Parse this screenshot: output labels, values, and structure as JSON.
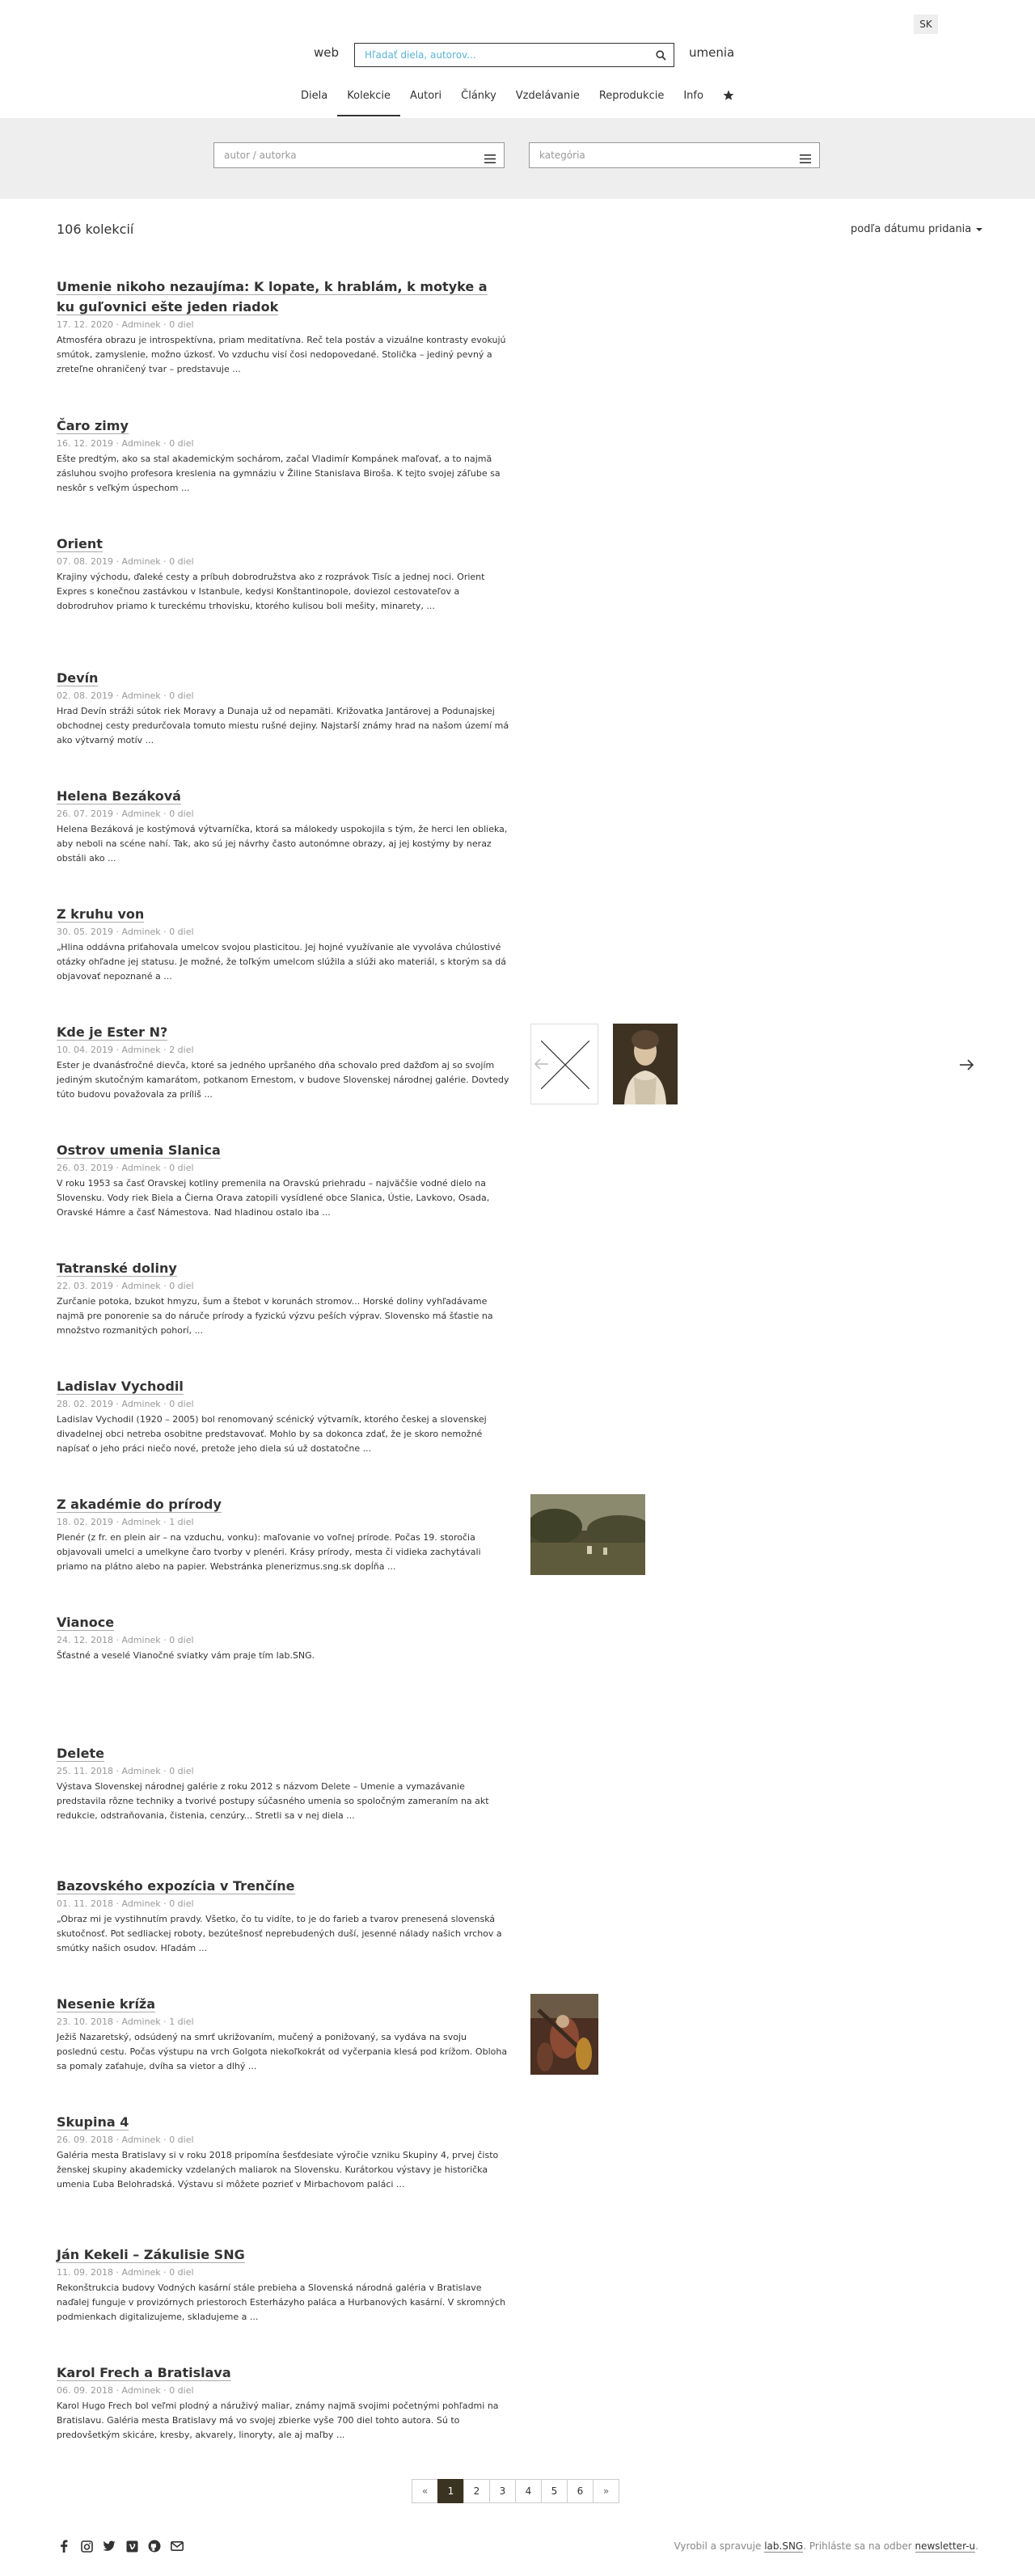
{
  "header": {
    "lang": "SK",
    "brand_left": "web",
    "brand_right": "umenia",
    "search_placeholder": "Hľadať diela, autorov..."
  },
  "nav": {
    "items": [
      {
        "label": "Diela"
      },
      {
        "label": "Kolekcie"
      },
      {
        "label": "Autori"
      },
      {
        "label": "Články"
      },
      {
        "label": "Vzdelávanie"
      },
      {
        "label": "Reprodukcie"
      },
      {
        "label": "Info"
      }
    ],
    "active": "Kolekcie"
  },
  "filters": {
    "author_placeholder": "autor / autorka",
    "category_placeholder": "kategória"
  },
  "count": "106 kolekcií",
  "sort": "podľa dátumu pridania",
  "items": [
    {
      "title": "Umenie nikoho nezaujíma: K lopate, k hrablám, k motyke a ku guľovnici ešte jeden riadok",
      "date": "17. 12. 2020",
      "author": "Adminek",
      "works": "0 diel",
      "excerpt": "Atmosféra obrazu je introspektívna, priam meditatívna. Reč tela postáv a vizuálne kontrasty evokujú smútok, zamyslenie, možno úzkosť. Vo vzduchu visí čosi nedopovedané. Stolička – jediný pevný a zreteľne ohraničený tvar – predstavuje ..."
    },
    {
      "title": "Čaro zimy",
      "date": "16. 12. 2019",
      "author": "Adminek",
      "works": "0 diel",
      "excerpt": "Ešte predtým, ako sa stal akademickým sochárom, začal Vladimír Kompánek maľovať, a to najmä zásluhou svojho profesora kreslenia na gymnáziu v Žiline Stanislava Biroša. K tejto svojej záľube sa neskôr s veľkým úspechom ..."
    },
    {
      "title": "Orient",
      "date": "07. 08. 2019",
      "author": "Adminek",
      "works": "0 diel",
      "excerpt": "Krajiny východu, ďaleké cesty a príbuh dobrodružstva ako z rozprávok Tisíc a jednej noci. Orient Expres s konečnou zastávkou v Istanbule, kedysi Konštantinopole, doviezol cestovateľov a dobrodruhov priamo k tureckému trhovisku, ktorého kulisou boli mešity, minarety, ..."
    },
    {
      "title": "Devín",
      "date": "02. 08. 2019",
      "author": "Adminek",
      "works": "0 diel",
      "excerpt": "Hrad Devín stráži sútok riek Moravy a Dunaja už od nepamäti. Križovatka Jantárovej a Podunajskej obchodnej cesty predurčovala tomuto miestu rušné dejiny. Najstarší známy hrad na našom území má ako výtvarný motív ..."
    },
    {
      "title": "Helena Bezáková",
      "date": "26. 07. 2019",
      "author": "Adminek",
      "works": "0 diel",
      "excerpt": "Helena Bezáková je kostýmová výtvarníčka, ktorá sa málokedy uspokojila s tým, že herci len oblieka, aby neboli na scéne nahí. Tak, ako sú jej návrhy často autonómne obrazy, aj jej kostýmy by neraz obstáli ako ..."
    },
    {
      "title": "Z kruhu von",
      "date": "30. 05. 2019",
      "author": "Adminek",
      "works": "0 diel",
      "excerpt": "„Hlina oddávna priťahovala umelcov svojou plasticitou. Jej hojné využívanie ale vyvoláva chúlostivé otázky ohľadne jej statusu. Je možné, že toľkým umelcom slúžila a slúži ako materiál, s ktorým sa dá objavovať nepoznané a ..."
    },
    {
      "title": "Kde je Ester N?",
      "date": "10. 04. 2019",
      "author": "Adminek",
      "works": "2 diel",
      "excerpt": "Ester je dvanásťročné dievča, ktoré sa jedného upršaného dňa schovalo pred dažďom aj so svojím jediným skutočným kamarátom, potkanom Ernestom, v budove Slovenskej národnej galérie. Dovtedy túto budovu považovala za príliš ..."
    },
    {
      "title": "Ostrov umenia Slanica",
      "date": "26. 03. 2019",
      "author": "Adminek",
      "works": "0 diel",
      "excerpt": "V roku 1953 sa časť Oravskej kotliny premenila na Oravskú priehradu – najväčšie vodné dielo na Slovensku. Vody riek Biela a Čierna Orava zatopili vysídlené obce Slanica, Ústie, Lavkovo, Osada, Oravské Hámre a časť Námestova. Nad hladinou ostalo iba ..."
    },
    {
      "title": "Tatranské doliny",
      "date": "22. 03. 2019",
      "author": "Adminek",
      "works": "0 diel",
      "excerpt": "Zurčanie potoka, bzukot hmyzu, šum a štebot v korunách stromov... Horské doliny vyhľadávame najmä pre ponorenie sa do náruče prírody a fyzickú výzvu peších výprav. Slovensko má šťastie na množstvo rozmanitých pohorí, ..."
    },
    {
      "title": "Ladislav Vychodil",
      "date": "28. 02. 2019",
      "author": "Adminek",
      "works": "0 diel",
      "excerpt": "Ladislav Vychodil (1920 – 2005) bol renomovaný scénický výtvarník, ktorého českej a slovenskej divadelnej obci netreba osobitne predstavovať. Mohlo by sa dokonca zdať, že je skoro nemožné napísať o jeho práci niečo nové, pretože jeho diela sú už dostatočne ..."
    },
    {
      "title": "Z akadémie do prírody",
      "date": "18. 02. 2019",
      "author": "Adminek",
      "works": "1 diel",
      "excerpt": "Plenér (z fr. en plein air – na vzduchu, vonku): maľovanie vo voľnej prírode. Počas 19. storočia objavovali umelci a umelkyne čaro tvorby v plenéri. Krásy prírody, mesta či vidieka zachytávali priamo na plátno alebo na papier. Webstránka plenerizmus.sng.sk dopĺňa ..."
    },
    {
      "title": "Vianoce",
      "date": "24. 12. 2018",
      "author": "Adminek",
      "works": "0 diel",
      "excerpt": "Šťastné a veselé Vianočné sviatky vám praje tím lab.SNG."
    },
    {
      "title": "Delete",
      "date": "25. 11. 2018",
      "author": "Adminek",
      "works": "0 diel",
      "excerpt": "Výstava Slovenskej národnej galérie z roku 2012 s názvom Delete – Umenie a vymazávanie predstavila rôzne techniky a tvorivé postupy súčasného umenia so spoločným zameraním na akt redukcie, odstraňovania, čistenia, cenzúry... Stretli sa v nej diela ..."
    },
    {
      "title": "Bazovského expozícia v Trenčíne",
      "date": "01. 11. 2018",
      "author": "Adminek",
      "works": "0 diel",
      "excerpt": "„Obraz mi je vystihnutím pravdy. Všetko, čo tu vidíte, to je do farieb a tvarov prenesená slovenská skutočnosť. Pot sedliackej roboty, bezútešnosť neprebudených duší, jesenné nálady našich vrchov a smútky našich osudov. Hľadám ..."
    },
    {
      "title": "Nesenie kríža",
      "date": "23. 10. 2018",
      "author": "Adminek",
      "works": "1 diel",
      "excerpt": "Ježiš Nazaretský, odsúdený na smrť ukrižovaním, mučený a ponižovaný, sa vydáva na svoju poslednú cestu. Počas výstupu na vrch Golgota niekoľkokrát od vyčerpania klesá pod krížom. Obloha sa pomaly zaťahuje, dvíha sa vietor a dlhý ..."
    },
    {
      "title": "Skupina 4",
      "date": "26. 09. 2018",
      "author": "Adminek",
      "works": "0 diel",
      "excerpt": "Galéria mesta Bratislavy si v roku 2018 pripomína šesťdesiate výročie vzniku Skupiny 4, prvej čisto ženskej skupiny akademicky vzdelaných maliarok na Slovensku. Kurátorkou výstavy je historička umenia Ľuba Belohradská. Výstavu si môžete pozrieť v Mirbachovom paláci ..."
    },
    {
      "title": "Ján Kekeli – Zákulisie SNG",
      "date": "11. 09. 2018",
      "author": "Adminek",
      "works": "0 diel",
      "excerpt": "Rekonštrukcia budovy Vodných kasární stále prebieha a Slovenská národná galéria v Bratislave naďalej funguje v provizórnych priestoroch Esterházyho paláca a Hurbanových kasární. V skromných podmienkach digitalizujeme, skladujeme a ..."
    },
    {
      "title": "Karol Frech a Bratislava",
      "date": "06. 09. 2018",
      "author": "Adminek",
      "works": "0 diel",
      "excerpt": "Karol Hugo Frech bol veľmi plodný a náruživý maliar, známy najmä svojimi početnými pohľadmi na Bratislavu. Galéria mesta Bratislavy má vo svojej zbierke vyše 700 diel tohto autora. Sú to predovšetkým skicáre, kresby, akvarely, linoryty, ale aj maľby ..."
    }
  ],
  "pagination": {
    "prev": "«",
    "pages": [
      "1",
      "2",
      "3",
      "4",
      "5",
      "6"
    ],
    "active": "1",
    "next": "»"
  },
  "footer": {
    "credit_prefix": "Vyrobil a spravuje ",
    "credit_brand": "lab.SNG",
    "credit_middle": ". Prihláste sa na odber ",
    "credit_link": "newsletter-u",
    "credit_suffix": ".",
    "social_icons": [
      "facebook-icon",
      "instagram-icon",
      "twitter-icon",
      "vimeo-icon",
      "github-icon",
      "mail-icon"
    ]
  },
  "colors": {
    "accent_link": "#5ab4d6",
    "active_page": "#3b3321",
    "filter_band": "#eeeeee"
  }
}
